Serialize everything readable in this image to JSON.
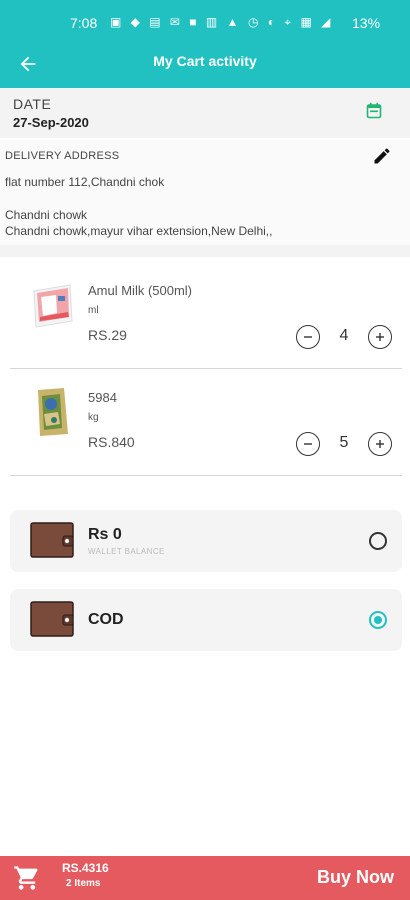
{
  "status_bar": {
    "time": "7:08",
    "battery": "13%"
  },
  "header": {
    "title": "My Cart activity"
  },
  "date": {
    "label": "DATE",
    "value": "27-Sep-2020"
  },
  "address": {
    "label": "DELIVERY ADDRESS",
    "line1": "flat number 112,Chandni chok",
    "line2": "Chandni chowk",
    "line3": "Chandni chowk,mayur vihar extension,New Delhi,,"
  },
  "items": [
    {
      "name": "Amul Milk (500ml)",
      "unit": "ml",
      "price": "RS.29",
      "qty": "4"
    },
    {
      "name": "5984",
      "unit": "kg",
      "price": "RS.840",
      "qty": "5"
    }
  ],
  "payment": {
    "wallet": {
      "title": "Rs 0",
      "subtitle": "WALLET BALANCE",
      "selected": false
    },
    "cod": {
      "title": "COD",
      "selected": true
    }
  },
  "bottom_bar": {
    "total": "RS.4316",
    "count": "2 Items",
    "buy_label": "Buy Now"
  },
  "colors": {
    "accent": "#22c1c1",
    "buy_bar": "#e45a5f",
    "wallet": "#7a4a3a"
  }
}
